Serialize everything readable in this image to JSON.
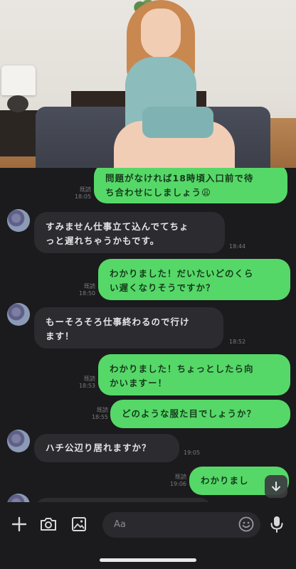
{
  "messages": [
    {
      "side": "out",
      "text": "問題がなければ18時頃入口前で待\nち合わせにしましょう😩",
      "status": "既読",
      "time": "18:05"
    },
    {
      "side": "in",
      "text": "すみません仕事立て込んでてちょ\nっと遅れちゃうかもです。",
      "time": "18:44"
    },
    {
      "side": "out",
      "text": "わかりました！だいたいどのくら\nい遅くなりそうですか？",
      "status": "既読",
      "time": "18:50"
    },
    {
      "side": "in",
      "text": "もーそろそろ仕事終わるので行け\nます！",
      "time": "18:52"
    },
    {
      "side": "out",
      "text": "わかりました！ちょっとしたら向\nかいますー！",
      "status": "既読",
      "time": "18:53"
    },
    {
      "side": "out",
      "text": "どのような服た目でしょうか？",
      "status": "既読",
      "time": "18:55"
    },
    {
      "side": "in",
      "text": "ハチ公辺り居れますか？",
      "time": "19:05"
    },
    {
      "side": "out",
      "text": "わかりまし",
      "status": "既読",
      "time": "19:06"
    }
  ],
  "input": {
    "placeholder": "Aa"
  },
  "icons": {
    "plus": "plus-icon",
    "camera": "camera-icon",
    "image": "image-icon",
    "emoji": "emoji-icon",
    "mic": "mic-icon",
    "scroll": "arrow-down-icon"
  },
  "colors": {
    "background": "#1b1b1d",
    "outgoing_bubble": "#56d868",
    "incoming_bubble": "#2c2c30"
  }
}
